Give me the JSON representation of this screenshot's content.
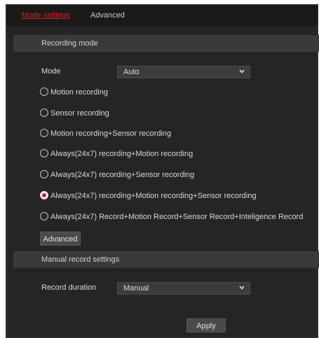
{
  "tabs": {
    "active": "Mode settings",
    "inactive": "Advanced"
  },
  "recording_mode": {
    "header": "Recording mode",
    "mode_label": "Mode",
    "mode_value": "Auto",
    "options": [
      "Motion recording",
      "Sensor recording",
      "Motion recording+Sensor recording",
      "Always(24x7) recording+Motion recording",
      "Always(24x7) recording+Sensor recording",
      "Always(24x7) recording+Motion recording+Sensor recording",
      "Always(24x7) Record+Motion Record+Sensor Record+Inteligence Record"
    ],
    "selected_index": 5,
    "advanced_button": "Advanced"
  },
  "manual_record": {
    "header": "Manual record settings",
    "duration_label": "Record duration",
    "duration_value": "Manual"
  },
  "apply_button": "Apply",
  "colors": {
    "accent": "#d81e1e",
    "panel": "#252525",
    "header": "#3a3a3a"
  },
  "icons": {
    "dropdown": "chevron-down-icon"
  }
}
